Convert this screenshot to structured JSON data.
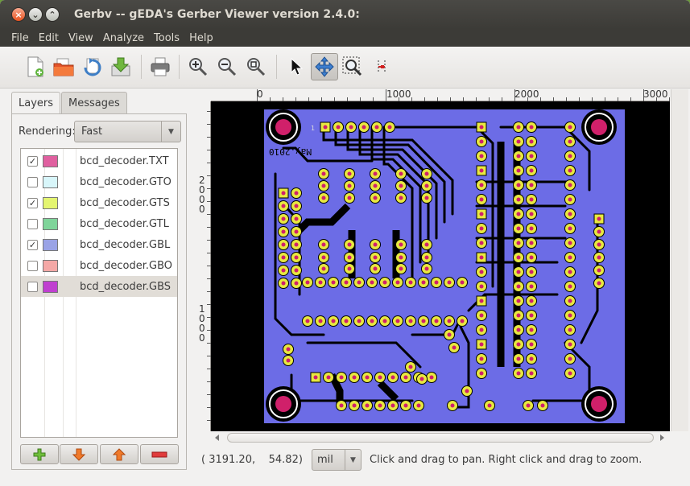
{
  "window": {
    "title": "Gerbv -- gEDA's Gerber Viewer version 2.4.0:",
    "buttons": {
      "close": "×",
      "minimize": "⌄",
      "maximize": "⌃"
    }
  },
  "menu": [
    "File",
    "Edit",
    "View",
    "Analyze",
    "Tools",
    "Help"
  ],
  "toolbar": {
    "icons": [
      "new-file-icon",
      "open-folder-icon",
      "revert-icon",
      "save-icon",
      "print-icon",
      "zoom-in-icon",
      "zoom-out-icon",
      "zoom-fit-icon",
      "pointer-icon",
      "pan-move-icon",
      "zoom-region-icon",
      "measure-icon"
    ],
    "active_tool": "pan-move-icon"
  },
  "tabs": {
    "layers": "Layers",
    "messages": "Messages",
    "active": "Layers"
  },
  "rendering": {
    "label": "Rendering:",
    "value": "Fast"
  },
  "layers": [
    {
      "name": "bcd_decoder.TXT",
      "visible": true,
      "checkmark": "✓",
      "color": "#e060a0"
    },
    {
      "name": "bcd_decoder.GTO",
      "visible": false,
      "checkmark": "",
      "color": "#d8f6fa"
    },
    {
      "name": "bcd_decoder.GTS",
      "visible": true,
      "checkmark": "✓",
      "color": "#e4f570"
    },
    {
      "name": "bcd_decoder.GTL",
      "visible": false,
      "checkmark": "",
      "color": "#7fd49a"
    },
    {
      "name": "bcd_decoder.GBL",
      "visible": true,
      "checkmark": "✓",
      "color": "#9aa3e6"
    },
    {
      "name": "bcd_decoder.GBO",
      "visible": false,
      "checkmark": "",
      "color": "#f4a8a6"
    },
    {
      "name": "bcd_decoder.GBS",
      "visible": false,
      "checkmark": "",
      "color": "#c040d0"
    }
  ],
  "selected_layer": "bcd_decoder.GBS",
  "layer_buttons": [
    "add-layer-icon",
    "move-down-icon",
    "move-up-icon",
    "remove-layer-icon"
  ],
  "ruler": {
    "horizontal": [
      "0",
      "1000",
      "2000",
      "3000"
    ],
    "vertical": [
      "2000",
      "1000"
    ]
  },
  "board": {
    "silk_text": "May.2010",
    "pin1_label": "1",
    "colors": {
      "background": "#000000",
      "copper": "#6c6ce6",
      "pad": "#e8e840",
      "mask": "#d0206a",
      "trace": "#000000"
    }
  },
  "status": {
    "coords": "( 3191.20,    54.82)",
    "unit": "mil",
    "hint": "Click and drag to pan. Right click and drag to zoom."
  }
}
